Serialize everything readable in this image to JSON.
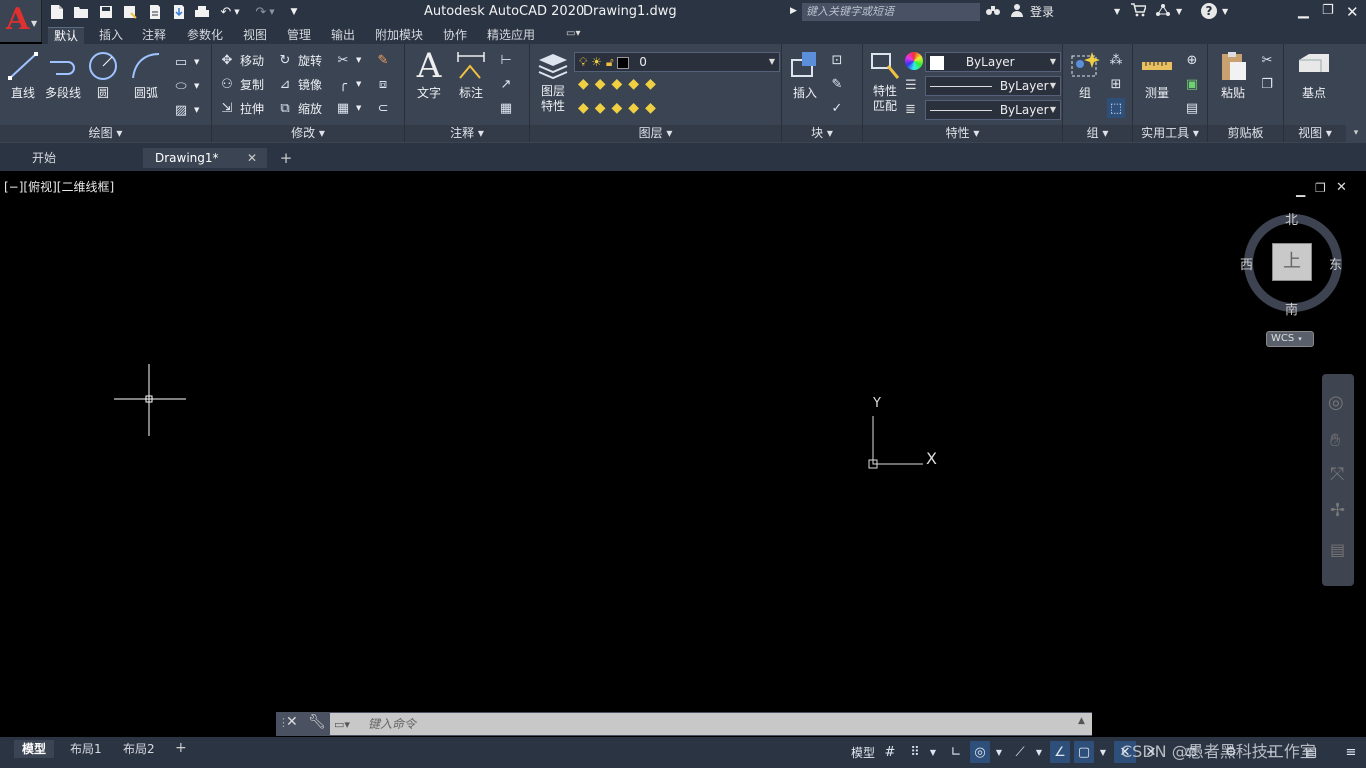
{
  "app": {
    "logo_letter": "A",
    "title": "Autodesk AutoCAD 2020",
    "document": "Drawing1.dwg",
    "search_placeholder": "键入关键字或短语",
    "login": "登录",
    "help": "?"
  },
  "ribbon_tabs": [
    "默认",
    "插入",
    "注释",
    "参数化",
    "视图",
    "管理",
    "输出",
    "附加模块",
    "协作",
    "精选应用"
  ],
  "panels": {
    "draw": {
      "title": "绘图",
      "buttons": [
        "直线",
        "多段线",
        "圆",
        "圆弧"
      ]
    },
    "modify": {
      "title": "修改",
      "rows": [
        [
          "移动",
          "旋转"
        ],
        [
          "复制",
          "镜像"
        ],
        [
          "拉伸",
          "缩放"
        ]
      ]
    },
    "annotation": {
      "title": "注释",
      "buttons": [
        "文字",
        "标注"
      ]
    },
    "layers": {
      "title": "图层",
      "button_line1": "图层",
      "button_line2": "特性",
      "current_layer": "0"
    },
    "block": {
      "title": "块",
      "button": "插入"
    },
    "properties": {
      "title": "特性",
      "button_line1": "特性",
      "button_line2": "匹配",
      "color": "ByLayer",
      "linetype": "ByLayer",
      "lineweight": "ByLayer"
    },
    "groups": {
      "title": "组",
      "button": "组"
    },
    "utilities": {
      "title": "实用工具",
      "button": "测量"
    },
    "clipboard": {
      "title": "剪贴板",
      "button": "粘贴"
    },
    "view": {
      "title": "视图",
      "button": "基点"
    }
  },
  "doc_tabs": [
    "开始",
    "Drawing1*"
  ],
  "viewport": {
    "label": "[−][俯视][二维线框]",
    "viewcube": {
      "north": "北",
      "south": "南",
      "east": "东",
      "west": "西",
      "top": "上",
      "wcs": "WCS"
    },
    "ucs": {
      "x": "X",
      "y": "Y"
    }
  },
  "command": {
    "placeholder": "键入命令"
  },
  "layout_tabs": [
    "模型",
    "布局1",
    "布局2"
  ],
  "status": {
    "model": "模型"
  },
  "watermark": "CSDN @愚者黑科技工作室"
}
